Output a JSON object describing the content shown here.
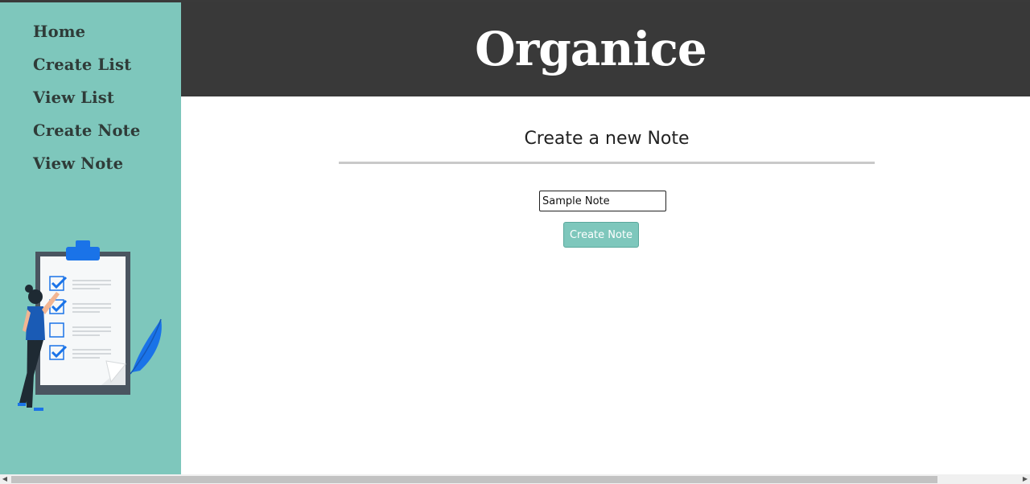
{
  "app": {
    "brand": "Organice"
  },
  "sidebar": {
    "items": [
      {
        "label": "Home"
      },
      {
        "label": "Create List"
      },
      {
        "label": "View List"
      },
      {
        "label": "Create Note"
      },
      {
        "label": "View Note"
      }
    ],
    "illustration_icon": "checklist-illustration"
  },
  "main": {
    "title": "Create a new Note",
    "note_input": {
      "value": "Sample Note",
      "placeholder": ""
    },
    "submit_label": "Create Note"
  },
  "colors": {
    "sidebar_bg": "#7ec7bc",
    "header_bg": "#393939",
    "accent": "#7ec7bc",
    "illustration_blue": "#1a73e8"
  },
  "scrollbar": {
    "left_arrow_icon": "left-arrow-icon",
    "right_arrow_icon": "right-arrow-icon"
  }
}
